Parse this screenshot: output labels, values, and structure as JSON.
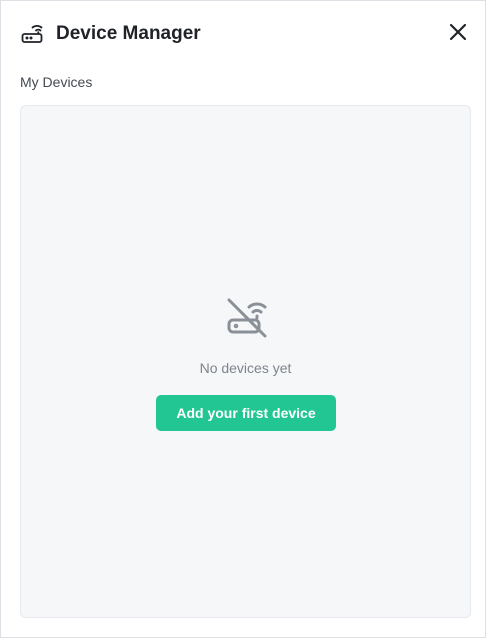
{
  "header": {
    "icon": "router-icon",
    "title": "Device Manager",
    "close_icon": "close-icon"
  },
  "devices": {
    "section_label": "My Devices",
    "empty_state": {
      "icon": "router-off-icon",
      "message": "No devices yet",
      "add_button_label": "Add your first device"
    }
  },
  "colors": {
    "accent": "#22c693",
    "empty_area_bg": "#f6f7f9",
    "icon_muted": "#8a9097",
    "title_text": "#1f2328"
  }
}
